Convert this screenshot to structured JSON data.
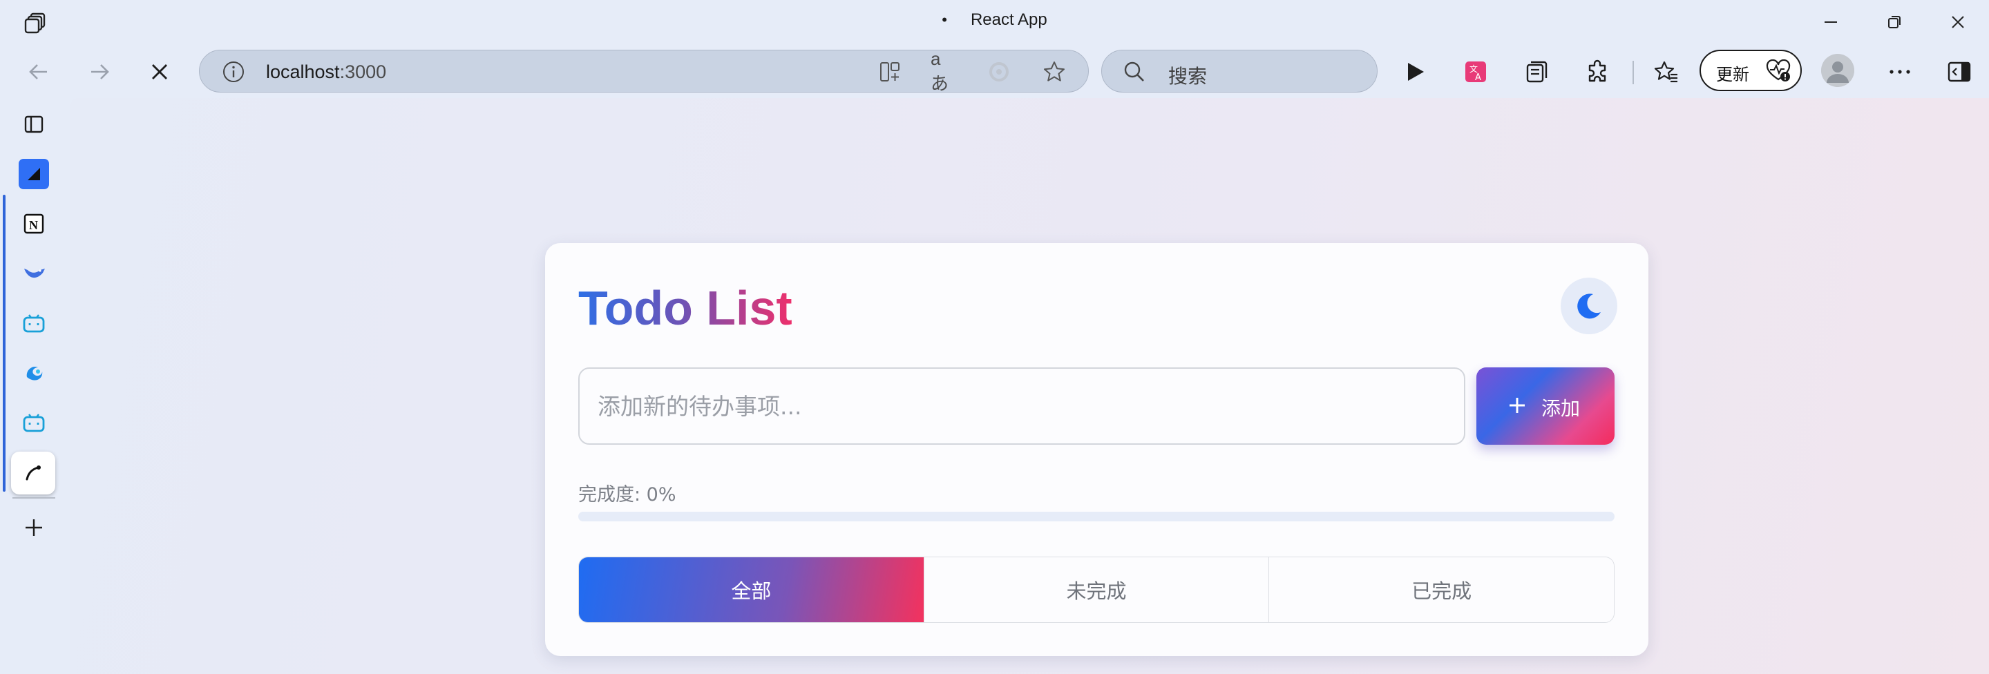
{
  "browser": {
    "tab_title": "React App",
    "tab_dot": "•",
    "address": {
      "host": "localhost",
      "port": ":3000"
    },
    "search": {
      "placeholder": "搜索"
    },
    "translate_label": "aあ",
    "update_button": "更新",
    "icons": {
      "workspaces": "workspaces-icon",
      "back": "arrow-left-icon",
      "forward": "arrow-right-icon",
      "stop": "close-icon",
      "site_info": "info-icon",
      "split_screen": "split-screen-icon",
      "read_aloud": "read-aloud-icon",
      "favorite": "star-icon",
      "search": "search-icon",
      "media": "play-icon",
      "translator": "translator-icon",
      "collections": "collections-icon",
      "extensions": "puzzle-icon",
      "favorites": "favorites-icon",
      "health": "heart-pulse-icon",
      "profile": "avatar-icon",
      "more": "more-icon",
      "sidebar_toggle": "sidebar-toggle-icon"
    }
  },
  "sidebar": {
    "items": [
      {
        "name": "tab-actions-icon"
      },
      {
        "name": "app-blue-square-icon",
        "color": "#2f6ff5"
      },
      {
        "name": "notion-icon"
      },
      {
        "name": "bird-app-icon"
      },
      {
        "name": "bilibili-icon"
      },
      {
        "name": "edge-copilot-icon"
      },
      {
        "name": "bilibili-icon"
      },
      {
        "name": "pen-app-icon"
      }
    ],
    "add_icon": "plus-icon"
  },
  "app": {
    "title": "Todo List",
    "theme_toggle_icon": "moon-icon",
    "input_placeholder": "添加新的待办事项...",
    "add_button": "添加",
    "progress": {
      "label": "完成度: 0%",
      "value": 0
    },
    "filters": [
      "全部",
      "未完成",
      "已完成"
    ],
    "active_filter": 0,
    "colors": {
      "accent_start": "#2f6fe5",
      "accent_end": "#ee2f6b",
      "moon": "#1f6cf2"
    }
  }
}
